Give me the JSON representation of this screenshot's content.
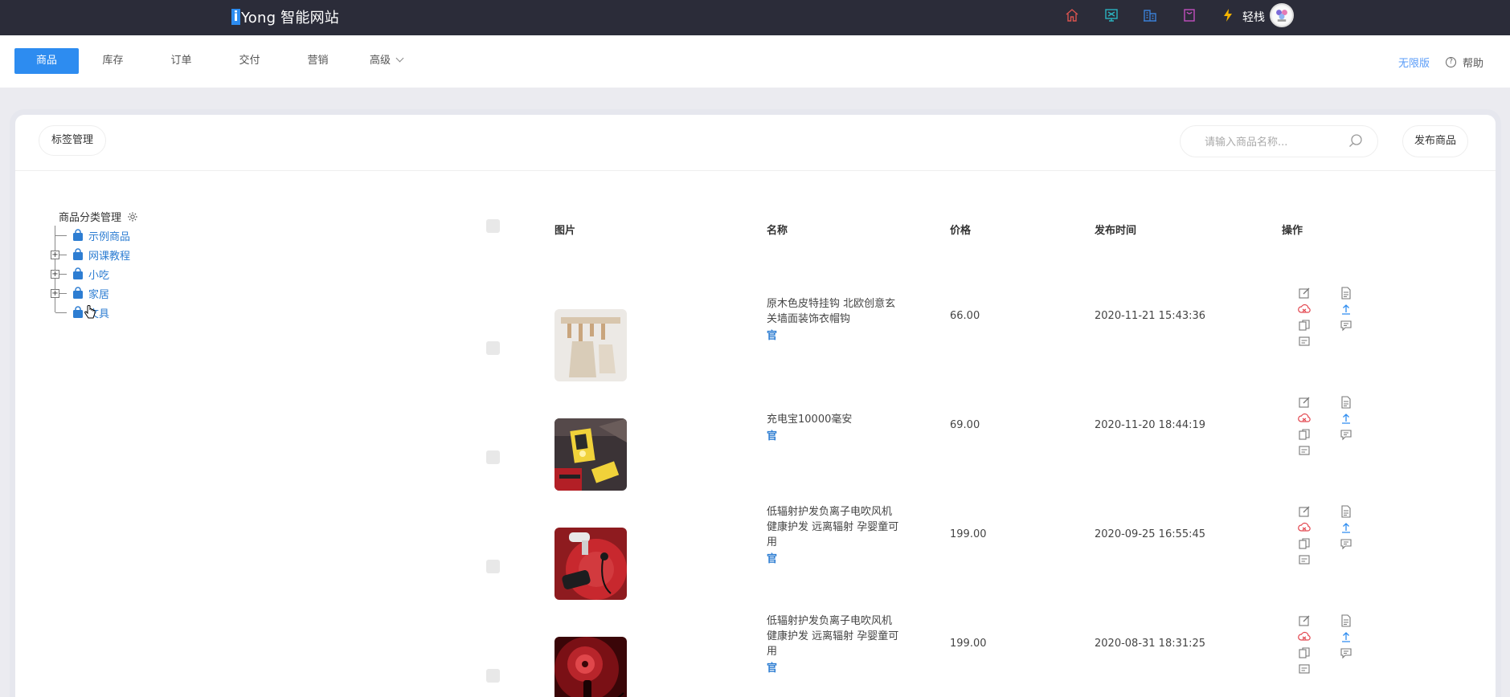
{
  "topbar": {
    "brand_mark": "i",
    "brand_name": "Yong 智能网站",
    "icons": [
      "home-icon",
      "monitor-icon",
      "building-icon",
      "bag-icon",
      "lightning-icon"
    ],
    "user_name": "轻栈"
  },
  "nav": {
    "tabs": [
      {
        "label": "商品",
        "active": true
      },
      {
        "label": "库存",
        "active": false
      },
      {
        "label": "订单",
        "active": false
      },
      {
        "label": "交付",
        "active": false
      },
      {
        "label": "营销",
        "active": false
      },
      {
        "label": "高级",
        "active": false,
        "has_dropdown": true
      }
    ],
    "pro_link": "无限版",
    "help": "帮助"
  },
  "toolbar": {
    "tag_button": "标签管理",
    "search_placeholder": "请输入商品名称...",
    "publish_button": "发布商品"
  },
  "categories": {
    "header": "商品分类管理",
    "items": [
      {
        "label": "示例商品",
        "expandable": false
      },
      {
        "label": "网课教程",
        "expandable": true
      },
      {
        "label": "小吃",
        "expandable": true
      },
      {
        "label": "家居",
        "expandable": true
      },
      {
        "label": "文具",
        "expandable": false
      }
    ]
  },
  "table": {
    "headers": {
      "image": "图片",
      "name": "名称",
      "price": "价格",
      "date": "发布时间",
      "actions": "操作"
    },
    "official_badge": "官",
    "rows": [
      {
        "name": "原木色皮特挂钩 北欧创意玄关墙面装饰衣帽钩",
        "price": "66.00",
        "date": "2020-11-21 15:43:36",
        "thumb": "hooks"
      },
      {
        "name": "充电宝10000毫安",
        "price": "69.00",
        "date": "2020-11-20 18:44:19",
        "thumb": "powerbank"
      },
      {
        "name": "低辐射护发负离子电吹风机 健康护发 远离辐射 孕婴童可用",
        "price": "199.00",
        "date": "2020-09-25 16:55:45",
        "thumb": "hairdryer-red"
      },
      {
        "name": "低辐射护发负离子电吹风机 健康护发 远离辐射 孕婴童可用",
        "price": "199.00",
        "date": "2020-08-31 18:31:25",
        "thumb": "hairdryer-dark"
      }
    ]
  },
  "colors": {
    "topbar_bg": "#2b2c39",
    "accent": "#2d8cf0",
    "link": "#2d7dd2",
    "danger": "#e2434c"
  }
}
